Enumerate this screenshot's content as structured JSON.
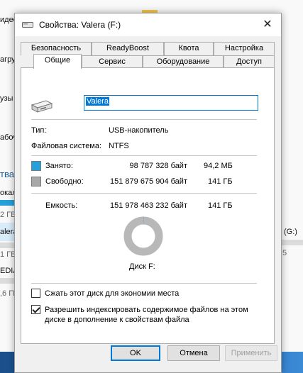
{
  "background": {
    "fragments": [
      "идео",
      "агру",
      "узы",
      "абоч",
      "тва",
      "окал",
      "2 ГБ",
      "alera",
      "1 ГБ",
      "EDIA",
      ",6 ГБ",
      "(G:)",
      "5"
    ]
  },
  "dialog": {
    "title": "Свойства: Valera (F:)",
    "close_glyph": "✕",
    "tabs_row1": [
      "Безопасность",
      "ReadyBoost",
      "Квота",
      "Настройка"
    ],
    "tabs_row2": [
      "Общие",
      "Сервис",
      "Оборудование",
      "Доступ"
    ],
    "active_tab": "Общие",
    "volume_name": "Valera",
    "type_label": "Тип:",
    "type_value": "USB-накопитель",
    "fs_label": "Файловая система:",
    "fs_value": "NTFS",
    "used": {
      "label": "Занято:",
      "bytes": "98 787 328 байт",
      "size": "94,2 МБ",
      "color": "#26a0da"
    },
    "free": {
      "label": "Свободно:",
      "bytes": "151 879 675 904 байт",
      "size": "141 ГБ",
      "color": "#a8a8a8"
    },
    "capacity": {
      "label": "Емкость:",
      "bytes": "151 978 463 232 байт",
      "size": "141 ГБ"
    },
    "used_fraction": 0.00065,
    "disk_label": "Диск F:",
    "compress": {
      "label": "Сжать этот диск для экономии места",
      "checked": false
    },
    "index": {
      "label_line1": "Разрешить индексировать содержимое файлов на этом",
      "label_line2": "диске в дополнение к свойствам файла",
      "checked": true
    },
    "buttons": {
      "ok": "OK",
      "cancel": "Отмена",
      "apply": "Применить"
    }
  }
}
